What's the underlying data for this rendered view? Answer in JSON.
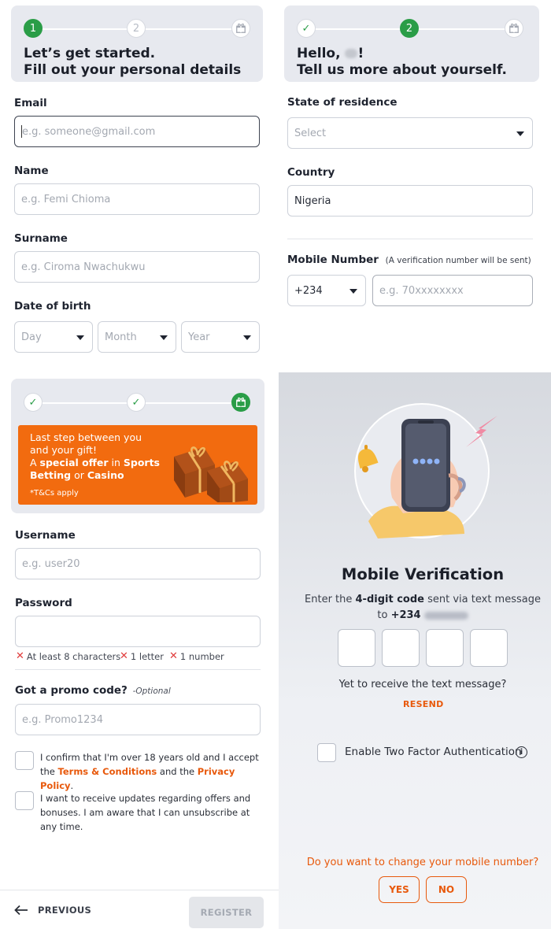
{
  "step1": {
    "steps": [
      "1",
      "2"
    ],
    "title_line1": "Let’s get started.",
    "title_line2": "Fill out your personal details",
    "email_label": "Email",
    "email_placeholder": "e.g. someone@gmail.com",
    "name_label": "Name",
    "name_placeholder": "e.g. Femi Chioma",
    "surname_label": "Surname",
    "surname_placeholder": "e.g. Ciroma Nwachukwu",
    "dob_label": "Date of birth",
    "day": "Day",
    "month": "Month",
    "year": "Year"
  },
  "step2": {
    "active_step": "2",
    "title_line1_prefix": "Hello, ",
    "title_line1_suffix": "!",
    "title_line2": "Tell us more about yourself.",
    "state_label": "State of residence",
    "state_value": "Select",
    "country_label": "Country",
    "country_value": "Nigeria",
    "mobile_label": "Mobile Number",
    "mobile_hint": "(A verification number will be sent)",
    "country_code": "+234",
    "mobile_placeholder": "e.g. 70xxxxxxxx"
  },
  "step3": {
    "promo_line1": "Last step between you",
    "promo_line2": "and your gift!",
    "promo_line3_a": "A ",
    "promo_line3_b": "special offer",
    "promo_line3_c": " in ",
    "promo_line3_d": "Sports",
    "promo_line4_a": "Betting",
    "promo_line4_b": " or ",
    "promo_line4_c": "Casino",
    "promo_tcs": "*T&Cs apply",
    "username_label": "Username",
    "username_placeholder": "e.g. user20",
    "password_label": "Password",
    "rule1": "At least 8 characters",
    "rule2": "1 letter",
    "rule3": "1 number",
    "promo_code_label": "Got a promo code?",
    "promo_code_optional": "-Optional",
    "promo_code_placeholder": "e.g. Promo1234",
    "confirm_text_a": "I confirm that I'm over 18 years old and I accept the",
    "terms_link": "Terms & Conditions",
    "confirm_text_b": " and the ",
    "privacy_link": "Privacy Policy",
    "confirm_text_c": ".",
    "updates_text": "I want to receive updates regarding offers and bonuses. I am aware that I can unsubscribe at any time.",
    "previous_label": "PREVIOUS",
    "register_label": "REGISTER"
  },
  "verification": {
    "title": "Mobile Verification",
    "desc_a": "Enter the ",
    "desc_code": "4-digit code",
    "desc_b": " sent via text message",
    "desc_to": "to ",
    "desc_prefix": "+234",
    "not_received": "Yet to receive the text message?",
    "resend": "RESEND",
    "two_factor": "Enable Two Factor Authentication",
    "change_number": "Do you want to change your mobile number?",
    "yes": "YES",
    "no": "NO"
  },
  "colors": {
    "accent": "#e8590c",
    "success": "#2a9d47",
    "card": "#e7e9ef"
  }
}
